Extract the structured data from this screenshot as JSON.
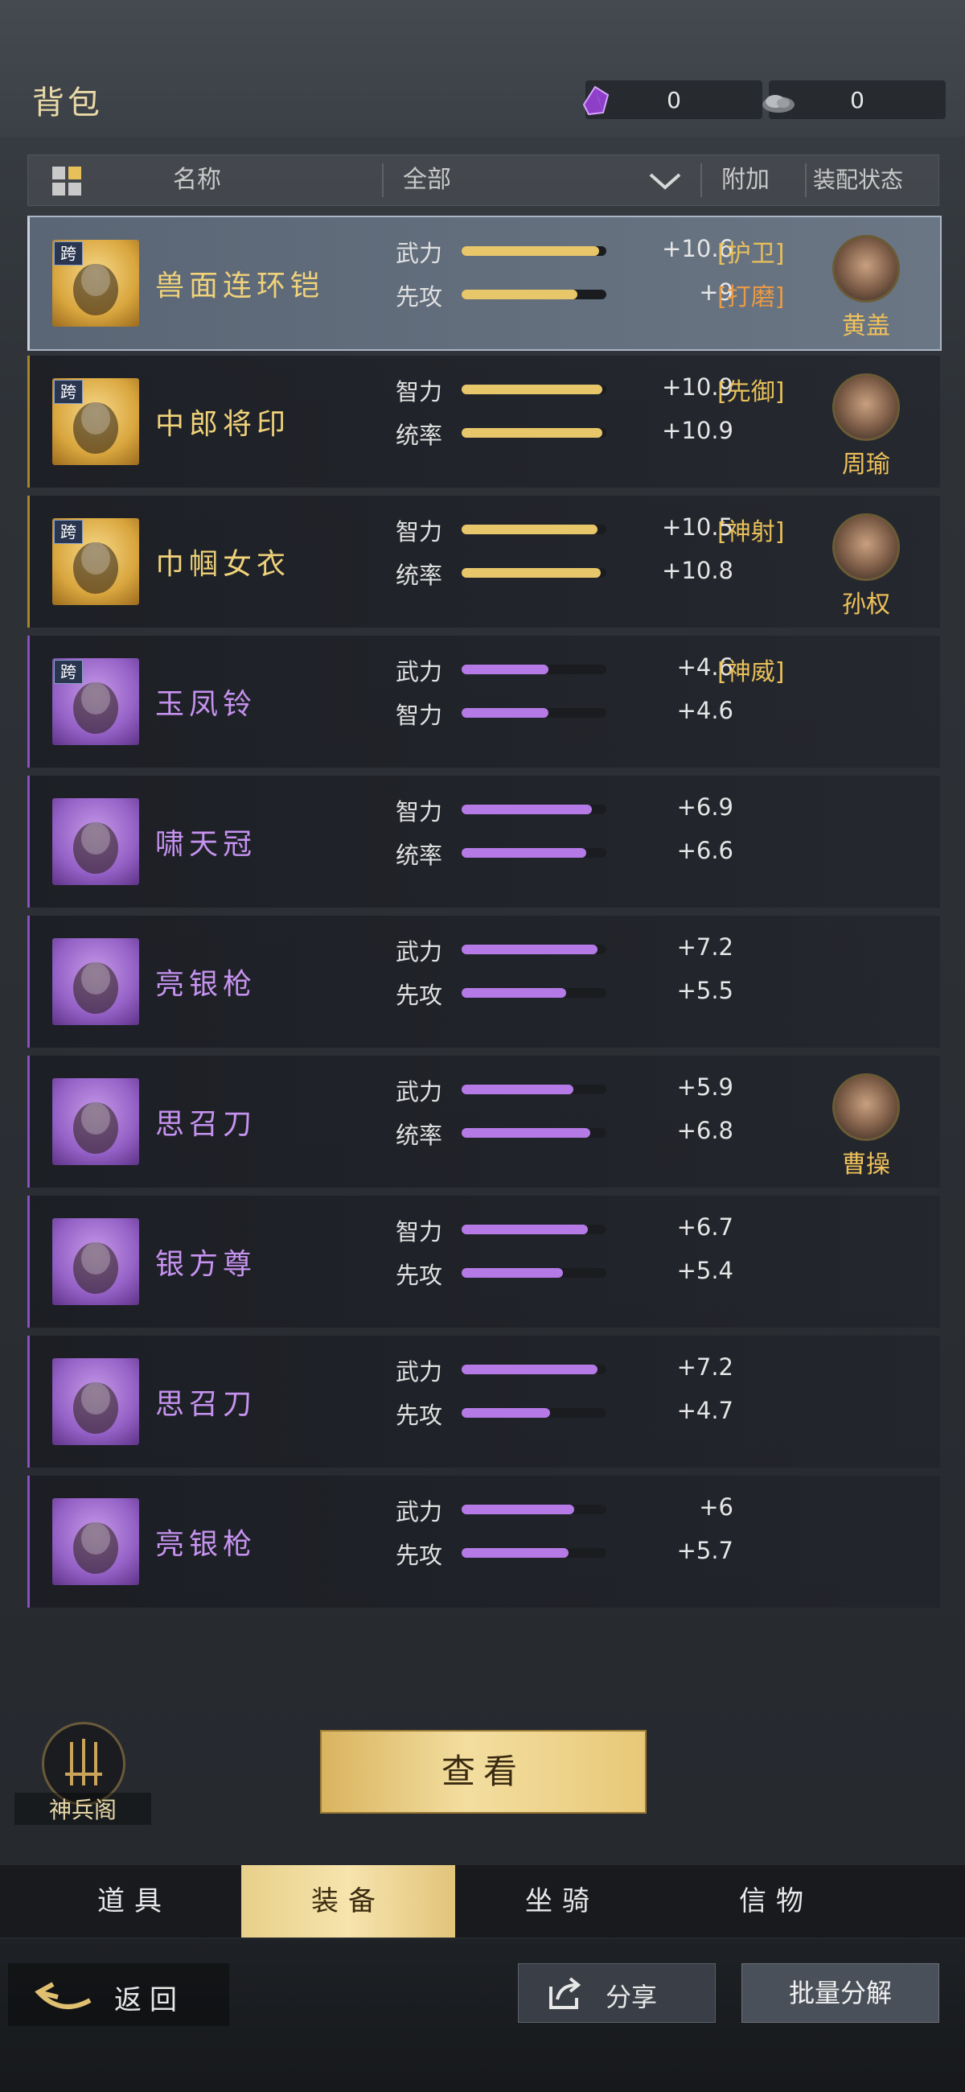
{
  "header": {
    "title": "背包"
  },
  "currencies": [
    {
      "name": "purple-crystal",
      "value": "0",
      "color": "#9a4ed8"
    },
    {
      "name": "silver-ore",
      "value": "0",
      "color": "#aaaaaa"
    }
  ],
  "filter": {
    "name_label": "名称",
    "category_value": "全部",
    "extra_label": "附加",
    "equip_status_label": "装配状态"
  },
  "items": [
    {
      "name": "兽面连环铠",
      "rarity": "gold",
      "cross": "跨",
      "selected": true,
      "stats": [
        {
          "label": "武力",
          "value": "+10.6",
          "fill": 0.95
        },
        {
          "label": "先攻",
          "value": "+9",
          "fill": 0.8
        }
      ],
      "tags": [
        "[护卫]",
        "[打磨]"
      ],
      "hero": "黄盖"
    },
    {
      "name": "中郎将印",
      "rarity": "gold",
      "cross": "跨",
      "stats": [
        {
          "label": "智力",
          "value": "+10.9",
          "fill": 0.97
        },
        {
          "label": "统率",
          "value": "+10.9",
          "fill": 0.97
        }
      ],
      "tags": [
        "[先御]"
      ],
      "hero": "周瑜"
    },
    {
      "name": "巾帼女衣",
      "rarity": "gold",
      "cross": "跨",
      "stats": [
        {
          "label": "智力",
          "value": "+10.5",
          "fill": 0.94
        },
        {
          "label": "统率",
          "value": "+10.8",
          "fill": 0.96
        }
      ],
      "tags": [
        "[神射]"
      ],
      "hero": "孙权"
    },
    {
      "name": "玉凤铃",
      "rarity": "violet",
      "cross": "跨",
      "stats": [
        {
          "label": "武力",
          "value": "+4.6",
          "fill": 0.6
        },
        {
          "label": "智力",
          "value": "+4.6",
          "fill": 0.6
        }
      ],
      "tags": [
        "[神威]"
      ],
      "hero": ""
    },
    {
      "name": "啸天冠",
      "rarity": "violet",
      "cross": "",
      "stats": [
        {
          "label": "智力",
          "value": "+6.9",
          "fill": 0.9
        },
        {
          "label": "统率",
          "value": "+6.6",
          "fill": 0.86
        }
      ],
      "tags": [],
      "hero": ""
    },
    {
      "name": "亮银枪",
      "rarity": "violet",
      "cross": "",
      "stats": [
        {
          "label": "武力",
          "value": "+7.2",
          "fill": 0.94
        },
        {
          "label": "先攻",
          "value": "+5.5",
          "fill": 0.72
        }
      ],
      "tags": [],
      "hero": ""
    },
    {
      "name": "思召刀",
      "rarity": "violet",
      "cross": "",
      "stats": [
        {
          "label": "武力",
          "value": "+5.9",
          "fill": 0.77
        },
        {
          "label": "统率",
          "value": "+6.8",
          "fill": 0.89
        }
      ],
      "tags": [],
      "hero": "曹操"
    },
    {
      "name": "银方尊",
      "rarity": "violet",
      "cross": "",
      "stats": [
        {
          "label": "智力",
          "value": "+6.7",
          "fill": 0.87
        },
        {
          "label": "先攻",
          "value": "+5.4",
          "fill": 0.7
        }
      ],
      "tags": [],
      "hero": ""
    },
    {
      "name": "思召刀",
      "rarity": "violet",
      "cross": "",
      "stats": [
        {
          "label": "武力",
          "value": "+7.2",
          "fill": 0.94
        },
        {
          "label": "先攻",
          "value": "+4.7",
          "fill": 0.61
        }
      ],
      "tags": [],
      "hero": ""
    },
    {
      "name": "亮银枪",
      "rarity": "violet",
      "cross": "",
      "stats": [
        {
          "label": "武力",
          "value": "+6",
          "fill": 0.78
        },
        {
          "label": "先攻",
          "value": "+5.7",
          "fill": 0.74
        }
      ],
      "tags": [],
      "hero": ""
    }
  ],
  "colors": {
    "gold_bar": "#e8c76a",
    "violet_bar": "#b57ae6"
  },
  "actions": {
    "view_label": "查看",
    "armory_label": "神兵阁",
    "back_label": "返回",
    "share_label": "分享",
    "decompose_label": "批量分解"
  },
  "tabs": [
    {
      "label": "道具"
    },
    {
      "label": "装备",
      "active": true
    },
    {
      "label": "坐骑"
    },
    {
      "label": "信物"
    }
  ]
}
